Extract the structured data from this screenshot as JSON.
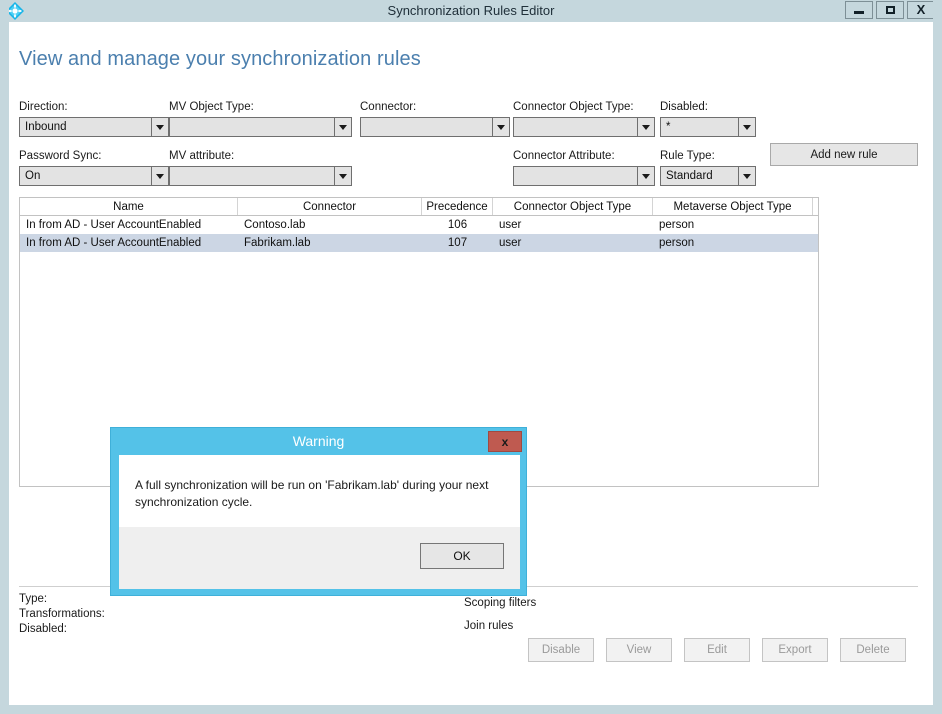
{
  "window": {
    "title": "Synchronization Rules Editor",
    "icon": "sync-rules-app-icon",
    "minimize_label": "Minimize",
    "maximize_label": "Maximize",
    "close_label": "X",
    "titlebar_color": "#c5d7dd"
  },
  "page": {
    "heading": "View and manage your synchronization rules",
    "heading_color": "#4b7fae"
  },
  "filters": [
    {
      "label": "Direction:",
      "value": "Inbound",
      "name": "direction"
    },
    {
      "label": "MV Object Type:",
      "value": "",
      "name": "mv-object-type"
    },
    {
      "label": "Connector:",
      "value": "",
      "name": "connector"
    },
    {
      "label": "Connector Object Type:",
      "value": "",
      "name": "connector-object-type"
    },
    {
      "label": "Disabled:",
      "value": "*",
      "name": "disabled"
    },
    {
      "label": "Password Sync:",
      "value": "On",
      "name": "password-sync"
    },
    {
      "label": "MV attribute:",
      "value": "",
      "name": "mv-attribute"
    },
    {
      "label": "Connector Attribute:",
      "value": "",
      "name": "connector-attribute"
    },
    {
      "label": "Rule Type:",
      "value": "Standard",
      "name": "rule-type"
    }
  ],
  "toolbar": {
    "add_new_rule": "Add new rule"
  },
  "grid": {
    "columns": [
      "Name",
      "Connector",
      "Precedence",
      "Connector Object Type",
      "Metaverse Object Type"
    ],
    "rows": [
      {
        "name": "In from AD - User AccountEnabled",
        "connector": "Contoso.lab",
        "precedence": "106",
        "connector_object_type": "user",
        "metaverse_object_type": "person",
        "selected": false
      },
      {
        "name": "In from AD - User AccountEnabled",
        "connector": "Fabrikam.lab",
        "precedence": "107",
        "connector_object_type": "user",
        "metaverse_object_type": "person",
        "selected": true
      }
    ],
    "selected_row_color": "#ccd6e4"
  },
  "details": {
    "left": [
      "Type:",
      "Transformations:",
      "Disabled:"
    ],
    "right": [
      "Scoping filters",
      "Join rules"
    ]
  },
  "actions": [
    {
      "label": "Disable",
      "name": "disable-button"
    },
    {
      "label": "View",
      "name": "view-button"
    },
    {
      "label": "Edit",
      "name": "edit-button"
    },
    {
      "label": "Export",
      "name": "export-button"
    },
    {
      "label": "Delete",
      "name": "delete-button"
    }
  ],
  "dialog": {
    "title": "Warning",
    "close_label": "x",
    "message": "A full synchronization will be run on 'Fabrikam.lab' during your next synchronization cycle.",
    "ok_label": "OK",
    "header_color": "#54c2e8",
    "close_color": "#bf5a50"
  }
}
